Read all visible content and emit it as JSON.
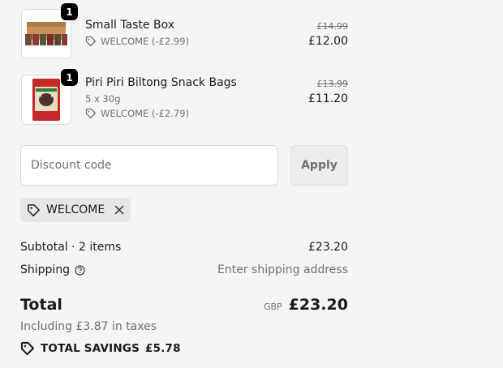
{
  "items": [
    {
      "name": "Small Taste Box",
      "quantity": "1",
      "variant": "",
      "discount": "WELCOME (-£2.99)",
      "original_price": "£14.99",
      "price": "£12.00",
      "image": "taste-box-product-image"
    },
    {
      "name": "Piri Piri Biltong Snack Bags",
      "quantity": "1",
      "variant": "5 x 30g",
      "discount": "WELCOME (-£2.79)",
      "original_price": "£13.99",
      "price": "£11.20",
      "image": "biltong-bag-product-image"
    }
  ],
  "discount_form": {
    "placeholder": "Discount code",
    "value": "",
    "apply_label": "Apply"
  },
  "applied_code": {
    "code": "WELCOME"
  },
  "summary": {
    "subtotal_label": "Subtotal · 2 items",
    "subtotal_value": "£23.20",
    "shipping_label": "Shipping",
    "shipping_value": "Enter shipping address",
    "total_label": "Total",
    "currency": "GBP",
    "total_value": "£23.20",
    "taxes_note": "Including £3.87 in taxes",
    "savings_label": "TOTAL SAVINGS",
    "savings_value": "£5.78"
  },
  "colors": {
    "background": "#f5f5f5",
    "text": "#1a1a1a",
    "muted": "#707070",
    "badge": "#000000"
  }
}
